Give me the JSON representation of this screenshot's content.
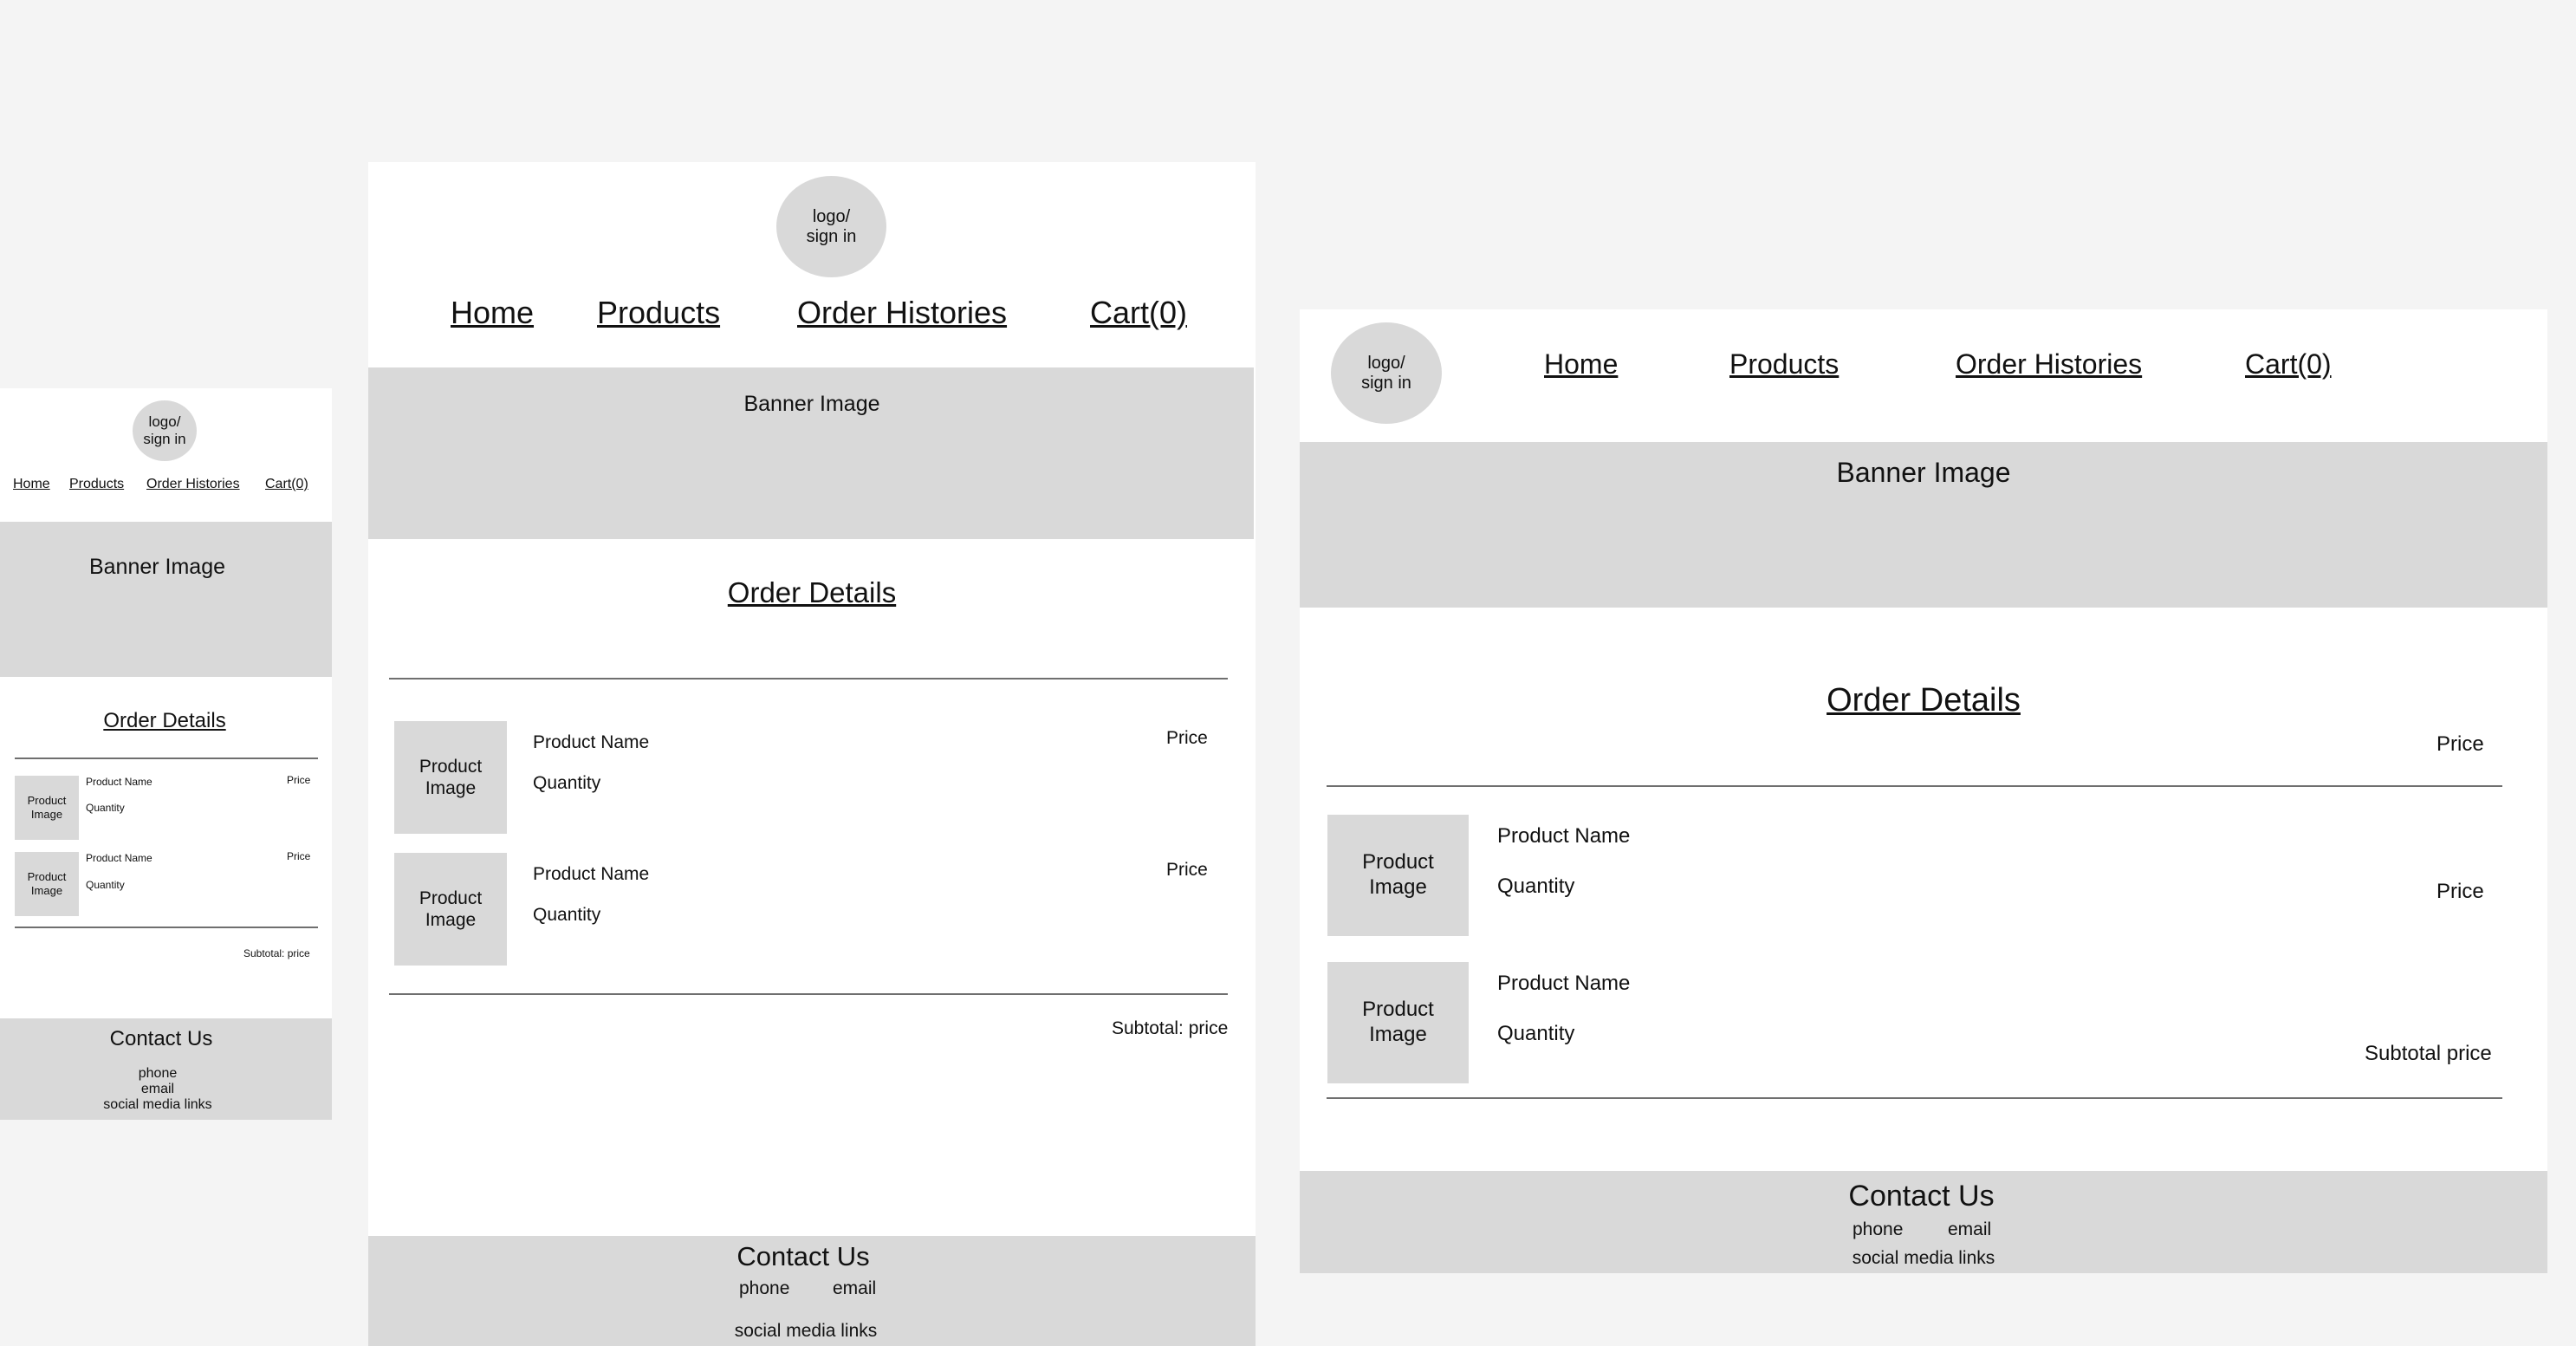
{
  "logo": "logo/\nsign in",
  "nav": {
    "home": "Home",
    "products": "Products",
    "order_histories": "Order Histories",
    "cart": "Cart(0)"
  },
  "banner": "Banner Image",
  "order_details_title": "Order Details",
  "items": [
    {
      "image": "Product Image",
      "name": "Product Name",
      "quantity": "Quantity",
      "price": "Price"
    },
    {
      "image": "Product Image",
      "name": "Product Name",
      "quantity": "Quantity",
      "price": "Price"
    }
  ],
  "subtotal_colon": "Subtotal: price",
  "subtotal_desktop": "Subtotal price",
  "contact": {
    "title": "Contact Us",
    "phone": "phone",
    "email": "email",
    "social": "social media links"
  },
  "colors": {
    "page_bg": "#f4f4f4",
    "frame_bg": "#ffffff",
    "placeholder": "#d9d9d9",
    "divider": "#6f6f6f"
  }
}
